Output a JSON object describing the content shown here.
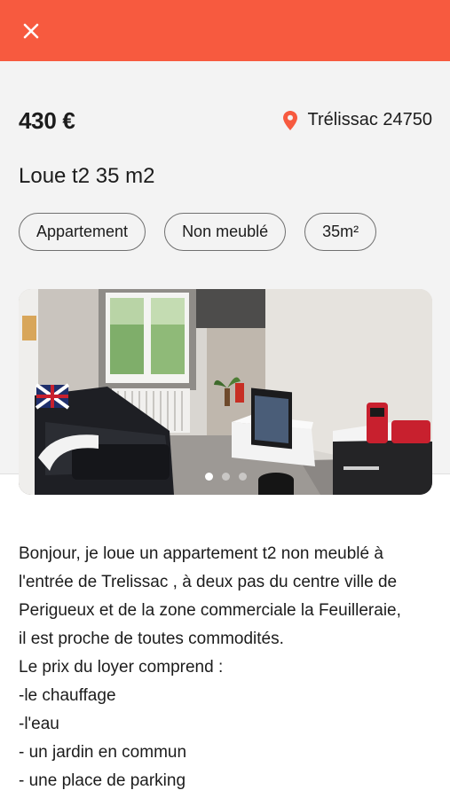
{
  "header": {
    "close_icon": "close-icon",
    "bar_color": "#f75a3f"
  },
  "listing": {
    "price": "430 €",
    "location": "Trélissac 24750",
    "title": "Loue t2 35 m2",
    "tags": [
      "Appartement",
      "Non meublé",
      "35m²"
    ],
    "photo": {
      "total_images": 3,
      "current_index": 1
    },
    "description_lines": [
      "Bonjour, je loue un appartement t2 non meublé à",
      "l'entrée de Trelissac , à deux pas du centre ville de",
      "Perigueux et de la zone commerciale la Feuilleraie,",
      "il est proche de toutes commodités.",
      "Le prix du loyer comprend :",
      "-le chauffage",
      "-l'eau",
      "- un jardin en commun",
      "- une place de parking"
    ]
  }
}
